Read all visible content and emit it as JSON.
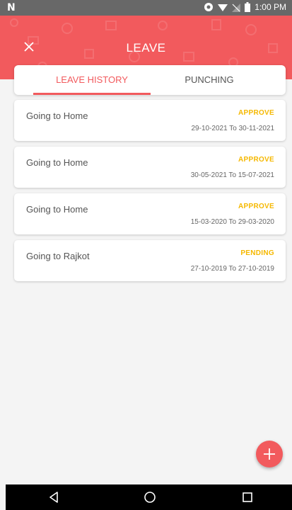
{
  "status_bar": {
    "time": "1:00 PM",
    "notification_glyph": "N"
  },
  "header": {
    "title": "LEAVE",
    "close_icon": "close-icon",
    "color": "#f25a5d"
  },
  "tabs": [
    {
      "label": "LEAVE HISTORY",
      "active": true
    },
    {
      "label": "PUNCHING",
      "active": false
    }
  ],
  "leaves": [
    {
      "reason": "Going to Home",
      "status": "APPROVE",
      "dates": "29-10-2021 To 30-11-2021"
    },
    {
      "reason": "Going to Home",
      "status": "APPROVE",
      "dates": "30-05-2021 To 15-07-2021"
    },
    {
      "reason": "Going to Home",
      "status": "APPROVE",
      "dates": "15-03-2020 To 29-03-2020"
    },
    {
      "reason": "Going to Rajkot",
      "status": "PENDING",
      "dates": "27-10-2019 To 27-10-2019"
    }
  ],
  "status_colors": {
    "approve": "#f5b800",
    "pending": "#f5b800"
  },
  "fab": {
    "icon": "plus-icon"
  },
  "nav": {
    "back": "back-icon",
    "home": "home-icon",
    "recent": "recent-apps-icon"
  }
}
